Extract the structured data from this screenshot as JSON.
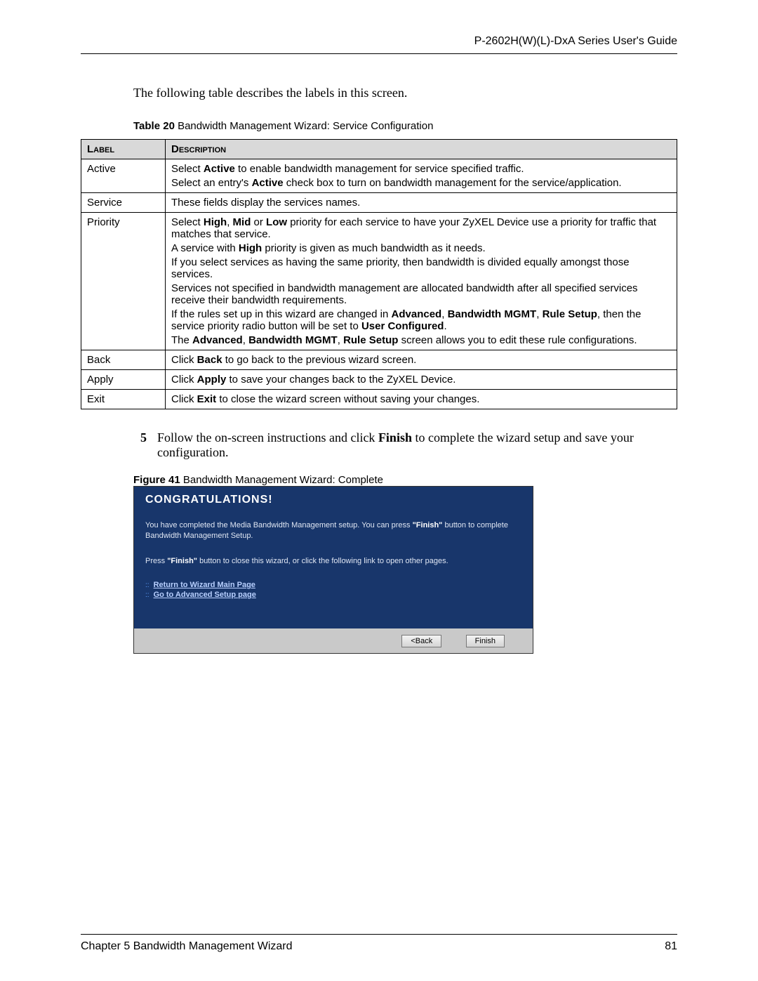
{
  "header": {
    "title": "P-2602H(W)(L)-DxA Series User's Guide"
  },
  "intro": "The following table describes the labels in this screen.",
  "table_caption": {
    "prefix": "Table 20",
    "text": "   Bandwidth Management Wizard: Service Configuration"
  },
  "table_headers": {
    "label": "Label",
    "description": "Description"
  },
  "rows": [
    {
      "label": "Active",
      "lines": [
        [
          {
            "t": "Select "
          },
          {
            "t": "Active",
            "b": true
          },
          {
            "t": " to enable bandwidth management for service specified traffic."
          }
        ],
        [
          {
            "t": "Select an entry's "
          },
          {
            "t": "Active",
            "b": true
          },
          {
            "t": " check box to turn on bandwidth management for the service/application."
          }
        ]
      ]
    },
    {
      "label": "Service",
      "lines": [
        [
          {
            "t": "These fields display the services names."
          }
        ]
      ]
    },
    {
      "label": "Priority",
      "lines": [
        [
          {
            "t": "Select "
          },
          {
            "t": "High",
            "b": true
          },
          {
            "t": ", "
          },
          {
            "t": "Mid",
            "b": true
          },
          {
            "t": " or "
          },
          {
            "t": "Low",
            "b": true
          },
          {
            "t": " priority for each service to have your ZyXEL Device use a priority for traffic that matches that service."
          }
        ],
        [
          {
            "t": "A service with "
          },
          {
            "t": "High",
            "b": true
          },
          {
            "t": " priority is given as much bandwidth as it needs."
          }
        ],
        [
          {
            "t": "If you select services as having the same priority, then bandwidth is divided equally amongst those services."
          }
        ],
        [
          {
            "t": "Services not specified in bandwidth management are allocated bandwidth after all specified services receive their bandwidth requirements."
          }
        ],
        [
          {
            "t": "If the rules set up in this wizard are changed in "
          },
          {
            "t": "Advanced",
            "b": true
          },
          {
            "t": ", "
          },
          {
            "t": "Bandwidth MGMT",
            "b": true
          },
          {
            "t": ", "
          },
          {
            "t": "Rule Setup",
            "b": true
          },
          {
            "t": ", then the service priority radio button will be set to "
          },
          {
            "t": "User Configured",
            "b": true
          },
          {
            "t": "."
          }
        ],
        [
          {
            "t": "The "
          },
          {
            "t": "Advanced",
            "b": true
          },
          {
            "t": ", "
          },
          {
            "t": "Bandwidth MGMT",
            "b": true
          },
          {
            "t": ", "
          },
          {
            "t": "Rule Setup",
            "b": true
          },
          {
            "t": " screen allows you to edit these rule configurations."
          }
        ]
      ]
    },
    {
      "label": "Back",
      "lines": [
        [
          {
            "t": "Click "
          },
          {
            "t": "Back",
            "b": true
          },
          {
            "t": " to go back to the previous wizard screen."
          }
        ]
      ]
    },
    {
      "label": "Apply",
      "lines": [
        [
          {
            "t": "Click "
          },
          {
            "t": "Apply",
            "b": true
          },
          {
            "t": " to save your changes back to the ZyXEL Device."
          }
        ]
      ]
    },
    {
      "label": "Exit",
      "lines": [
        [
          {
            "t": "Click "
          },
          {
            "t": "Exit",
            "b": true
          },
          {
            "t": " to close the wizard screen without saving your changes."
          }
        ]
      ]
    }
  ],
  "step": {
    "num": "5",
    "segments": [
      {
        "t": "Follow the on-screen instructions and click "
      },
      {
        "t": "Finish",
        "b": true
      },
      {
        "t": " to complete the wizard setup and save your configuration."
      }
    ]
  },
  "figure_caption": {
    "prefix": "Figure 41",
    "text": "   Bandwidth Management Wizard: Complete"
  },
  "wizard": {
    "title": "CONGRATULATIONS!",
    "p1_segments": [
      {
        "t": "You have completed the Media Bandwidth Management setup. You can press "
      },
      {
        "t": "\"Finish\"",
        "b": true
      },
      {
        "t": " button to complete Bandwidth Management Setup."
      }
    ],
    "p2_segments": [
      {
        "t": "Press "
      },
      {
        "t": "\"Finish\"",
        "b": true
      },
      {
        "t": " button to close this wizard, or click the following link to open other pages."
      }
    ],
    "link1": "Return to Wizard Main Page",
    "link2": "Go to Advanced Setup page",
    "back": "<Back",
    "finish": "Finish"
  },
  "footer": {
    "chapter": "Chapter 5 Bandwidth Management Wizard",
    "page": "81"
  }
}
